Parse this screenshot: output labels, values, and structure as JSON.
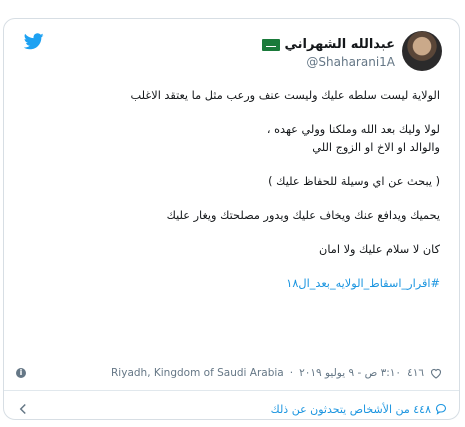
{
  "user": {
    "display_name": "عبدالله الشهراني",
    "handle": "@Shaharani1A"
  },
  "tweet": {
    "lines": [
      "الولاية ليست سلطه عليك وليست عنف ورعب مثل ما يعتقد الاغلب",
      "لولا وليك بعد الله وملكنا وولي عهده ،\nوالوالد او الاخ او الزوج اللي",
      "( يبحث عن اي وسيلة للحفاظ عليك )",
      "يحميك ويدافع عنك ويخاف عليك ويدور مصلحتك ويغار عليك",
      "كان لا سلام عليك ولا امان"
    ],
    "hashtag": "#اقرار_اسقاط_الولايه_بعد_ال١٨"
  },
  "meta": {
    "likes": "٤١٦",
    "timestamp": "٣:١٠ ص - ٩ يوليو ٢٠١٩",
    "location": "Riyadh, Kingdom of Saudi Arabia"
  },
  "footer": {
    "people_talking": "٤٤٨ من الأشخاص يتحدثون عن ذلك"
  },
  "colors": {
    "accent": "#1b95e0",
    "muted": "#657786"
  }
}
